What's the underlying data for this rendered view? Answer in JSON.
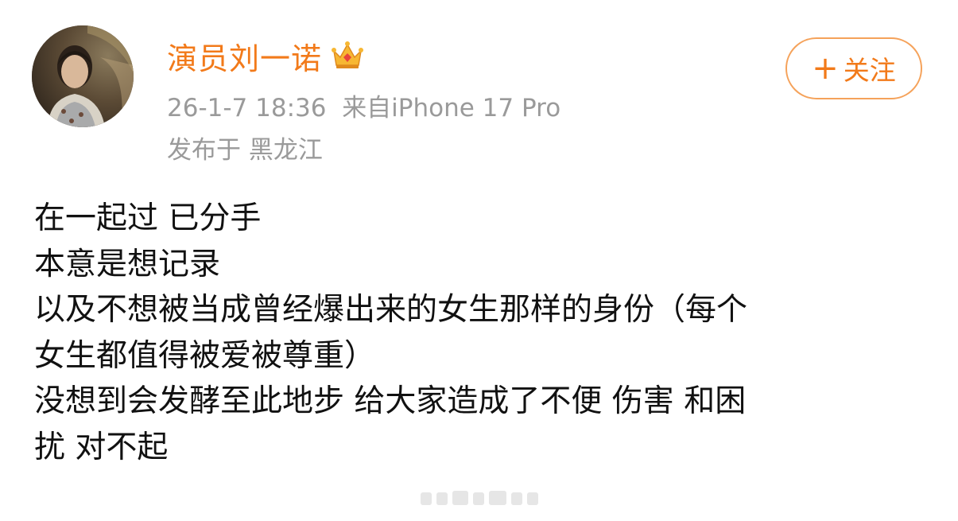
{
  "post": {
    "author": {
      "name": "演员刘一诺",
      "badge_icon": "crown-icon",
      "avatar_icon": "avatar-portrait"
    },
    "timestamp": "26-1-7 18:36",
    "source": "来自iPhone 17 Pro",
    "location": "发布于 黑龙江",
    "follow_button": {
      "plus": "+",
      "label": "关注"
    },
    "lines": [
      "在一起过 已分手",
      "本意是想记录",
      "以及不想被当成曾经爆出来的女生那样的身份（每个",
      "女生都值得被爱被尊重）",
      "没想到会发酵至此地步 给大家造成了不便 伤害 和困",
      "扰 对不起"
    ]
  },
  "colors": {
    "accent": "#f27a1a",
    "follow_border": "#f5a25a",
    "meta_text": "#9a9a9a",
    "body_text": "#111111"
  }
}
